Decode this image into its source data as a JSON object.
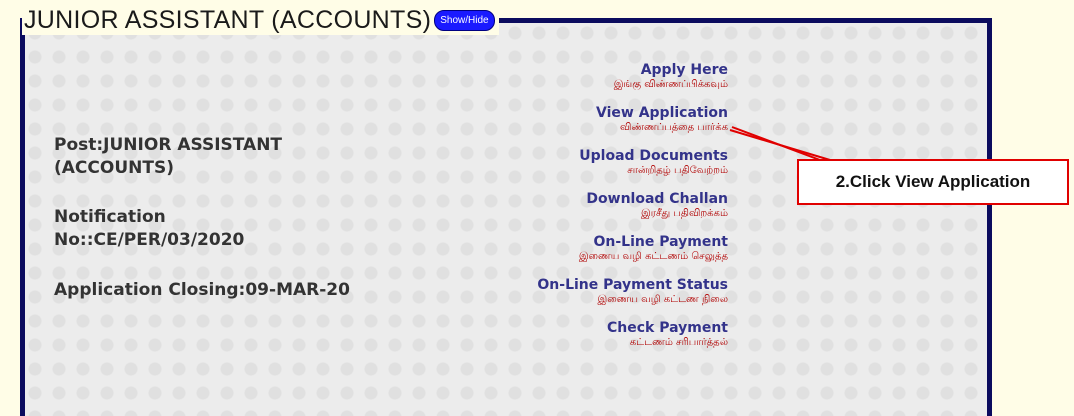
{
  "page": {
    "title": "JUNIOR ASSISTANT (ACCOUNTS)",
    "show_hide_label": "Show/Hide"
  },
  "info": {
    "post_line1": "Post:JUNIOR ASSISTANT",
    "post_line2": "(ACCOUNTS)",
    "notification_line1": "Notification",
    "notification_line2": "No::CE/PER/03/2020",
    "closing": "Application Closing:09-MAR-20"
  },
  "links": [
    {
      "label": "Apply Here",
      "tamil": "இங்கு விண்ணப்பிக்கவும்"
    },
    {
      "label": "View Application",
      "tamil": "விண்ணப்பத்தை பார்க்க"
    },
    {
      "label": "Upload Documents",
      "tamil": "சான்றிதழ் பதிவேற்றம்"
    },
    {
      "label": "Download Challan",
      "tamil": "இரசீது பதிவிறக்கம்"
    },
    {
      "label": "On-Line Payment",
      "tamil": "இணைய வழி கட்டணம் செலுத்த"
    },
    {
      "label": "On-Line Payment Status",
      "tamil": "இணைய வழி கட்டண நிலை"
    },
    {
      "label": "Check Payment",
      "tamil": "கட்டணம் சரிபார்த்தல்"
    }
  ],
  "callout": {
    "text": "2.Click View Application",
    "color": "#e00000"
  },
  "colors": {
    "frame": "#0b0b5e",
    "link": "#33338a",
    "tamil": "#b00000",
    "button": "#1a1aff"
  }
}
